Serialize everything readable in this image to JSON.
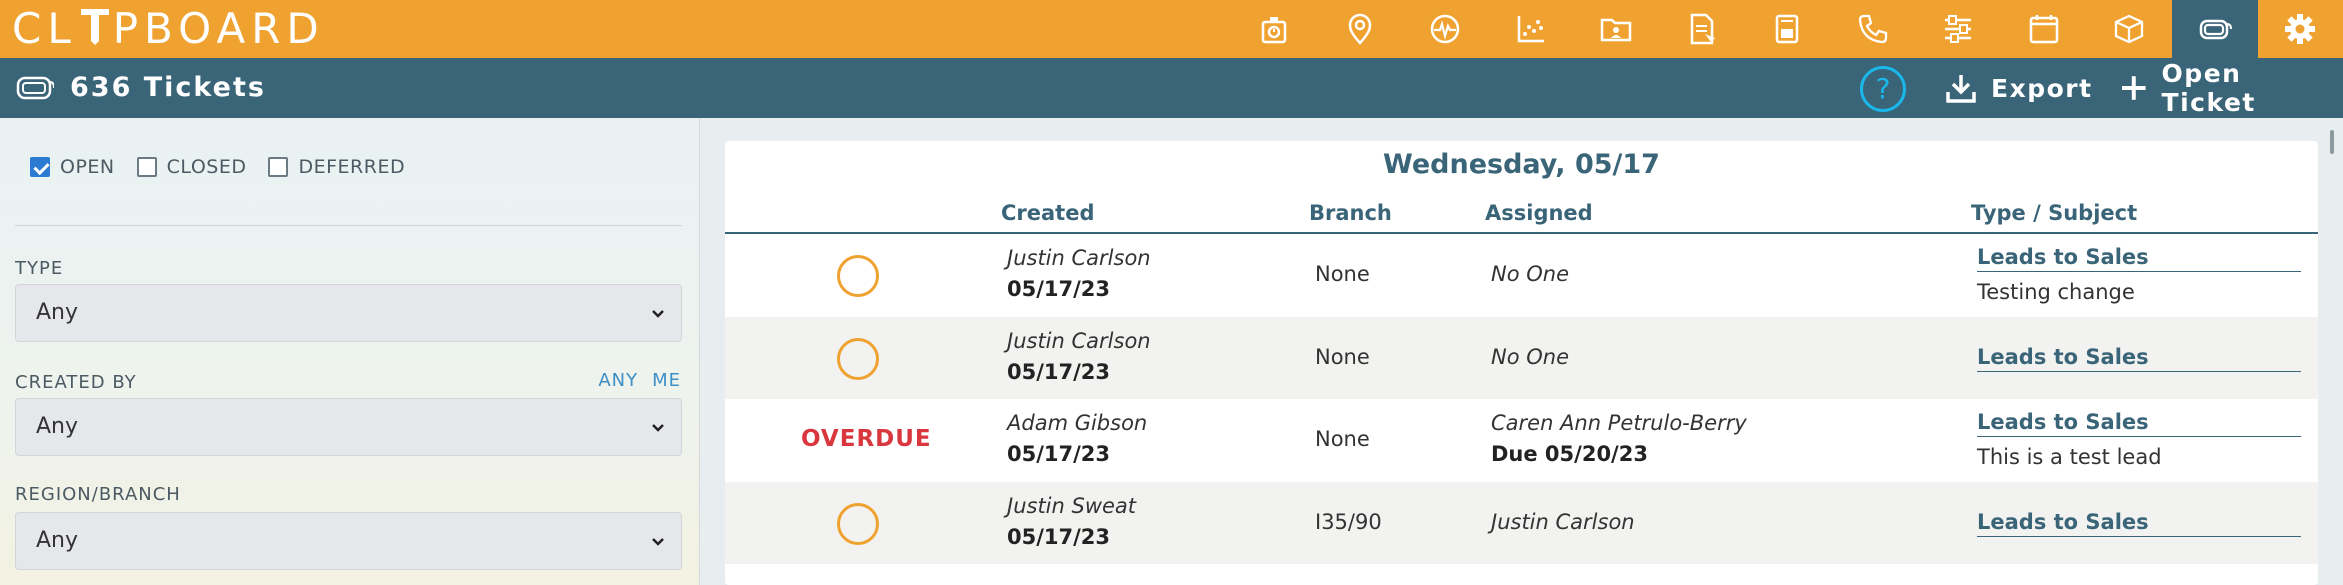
{
  "app": {
    "logo_text_left": "CL",
    "logo_text_right": "PBOARD"
  },
  "nav": {
    "icons": [
      "timer-icon",
      "map-pin-icon",
      "pulse-icon",
      "scatter-chart-icon",
      "folder-icon",
      "document-icon",
      "book-icon",
      "phone-icon",
      "sliders-icon",
      "calendar-icon",
      "cube-icon",
      "ticket-icon",
      "gear-icon"
    ],
    "active": "ticket-icon"
  },
  "header": {
    "title": "636 Tickets",
    "help_label": "?",
    "export_label": "Export",
    "open_ticket_label": "Open Ticket"
  },
  "filters": {
    "statuses": [
      {
        "label": "OPEN",
        "checked": true
      },
      {
        "label": "CLOSED",
        "checked": false
      },
      {
        "label": "DEFERRED",
        "checked": false
      }
    ],
    "type_label": "TYPE",
    "type_value": "Any",
    "created_by_label": "CREATED BY",
    "created_by_value": "Any",
    "quick_any": "ANY",
    "quick_me": "ME",
    "region_label": "REGION/BRANCH",
    "region_value": "Any"
  },
  "table": {
    "date_heading": "Wednesday, 05/17",
    "columns": {
      "created": "Created",
      "branch": "Branch",
      "assigned": "Assigned",
      "type": "Type / Subject"
    },
    "rows": [
      {
        "status": "",
        "creator": "Justin Carlson",
        "created_date": "05/17/23",
        "branch": "None",
        "assigned": "No One",
        "due": "",
        "type": "Leads to Sales",
        "subject": "Testing change"
      },
      {
        "status": "",
        "creator": "Justin Carlson",
        "created_date": "05/17/23",
        "branch": "None",
        "assigned": "No One",
        "due": "",
        "type": "Leads to Sales",
        "subject": ""
      },
      {
        "status": "OVERDUE",
        "creator": "Adam Gibson",
        "created_date": "05/17/23",
        "branch": "None",
        "assigned": "Caren Ann Petrulo-Berry",
        "due": "Due 05/20/23",
        "type": "Leads to Sales",
        "subject": "This is a test lead"
      },
      {
        "status": "",
        "creator": "Justin Sweat",
        "created_date": "05/17/23",
        "branch": "I35/90",
        "assigned": "Justin Carlson",
        "due": "",
        "type": "Leads to Sales",
        "subject": ""
      }
    ]
  },
  "colors": {
    "orange": "#f0a231",
    "teal": "#3a6478",
    "overdue_red": "#d9363e",
    "help_blue": "#1ab7ea"
  }
}
